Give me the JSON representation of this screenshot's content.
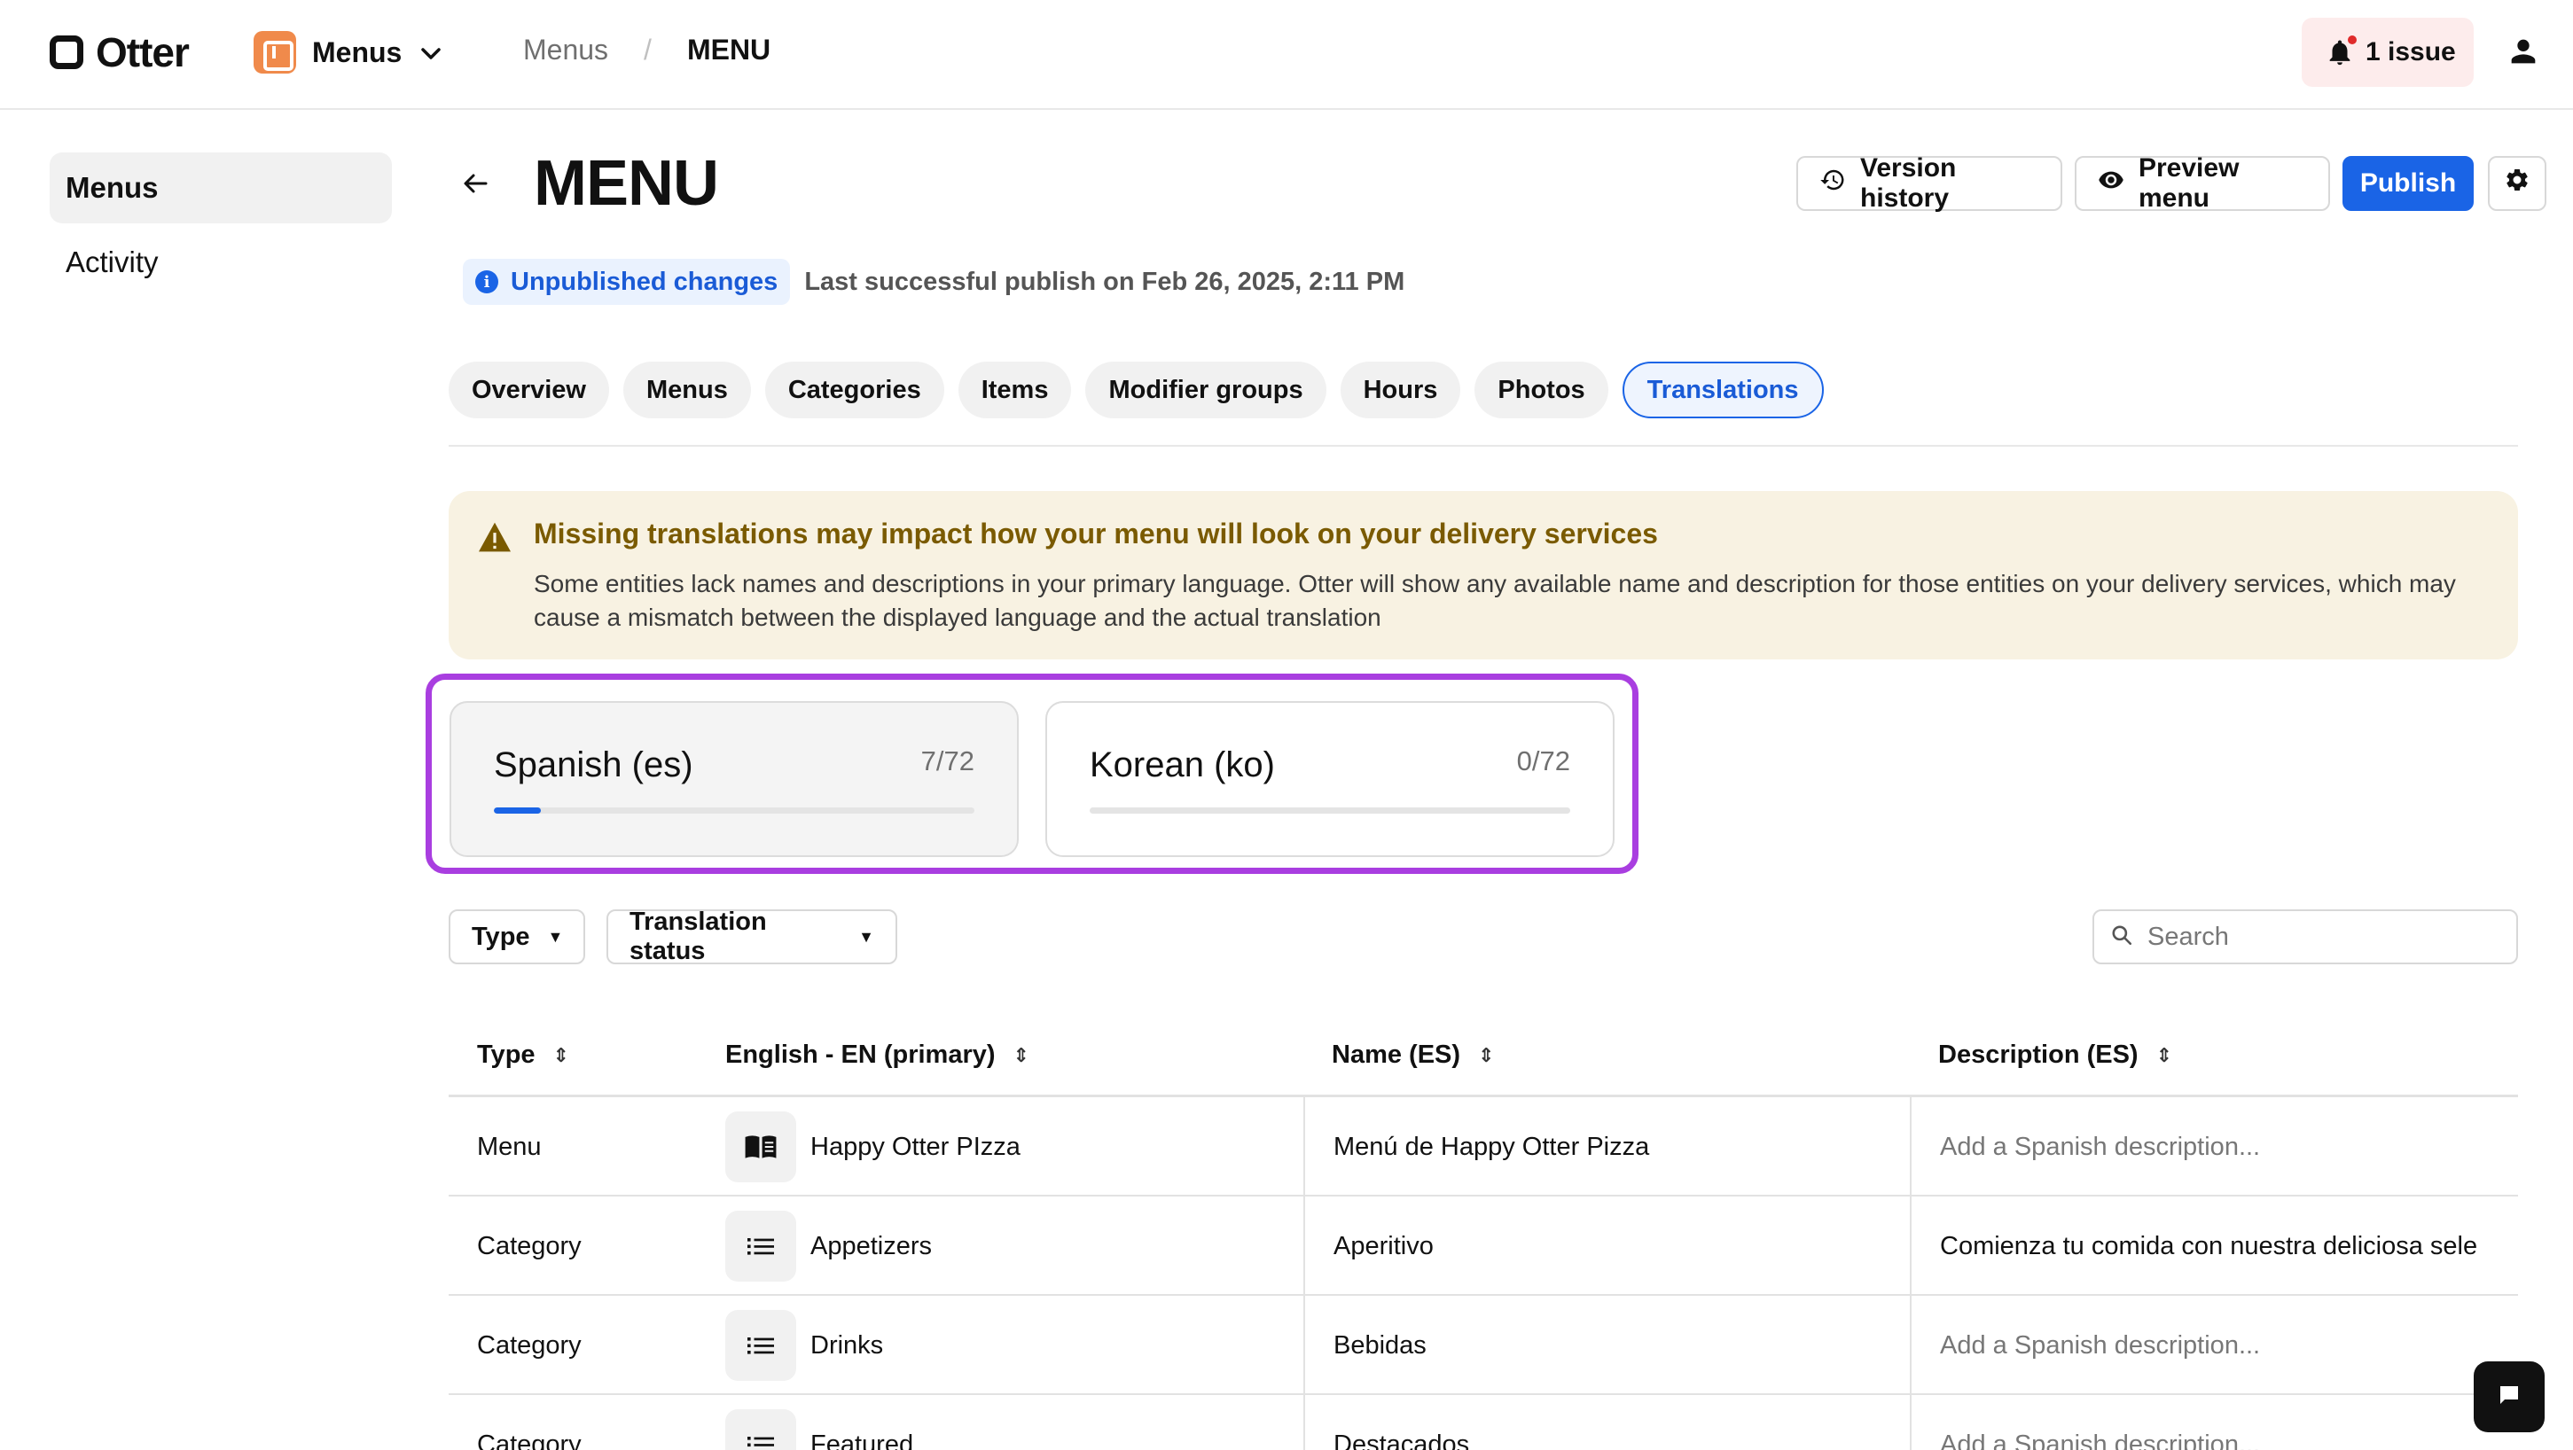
{
  "topbar": {
    "brand": "Otter",
    "app_name": "Menus",
    "breadcrumb": [
      "Menus",
      "MENU"
    ],
    "breadcrumb_sep": "/",
    "issues_label": "1 issue"
  },
  "sidebar": {
    "items": [
      {
        "label": "Menus",
        "active": true
      },
      {
        "label": "Activity",
        "active": false
      }
    ]
  },
  "header": {
    "title": "MENU",
    "version_history": "Version history",
    "preview_menu": "Preview menu",
    "publish": "Publish"
  },
  "status": {
    "badge": "Unpublished changes",
    "last_publish": "Last successful publish on Feb 26, 2025, 2:11 PM"
  },
  "tabs": [
    "Overview",
    "Menus",
    "Categories",
    "Items",
    "Modifier groups",
    "Hours",
    "Photos",
    "Translations"
  ],
  "active_tab": "Translations",
  "warning": {
    "title": "Missing translations may impact how your menu will look on your delivery services",
    "body": "Some entities lack names and descriptions in your primary language. Otter will show any available name and description for those entities on your delivery services, which may cause a mismatch between the displayed language and the actual translation"
  },
  "languages": [
    {
      "name": "Spanish (es)",
      "count": "7/72",
      "progress": 0.097,
      "selected": true
    },
    {
      "name": "Korean (ko)",
      "count": "0/72",
      "progress": 0,
      "selected": false
    }
  ],
  "filters": {
    "type": "Type",
    "translation_status": "Translation status",
    "search_placeholder": "Search"
  },
  "table": {
    "headers": [
      "Type",
      "English - EN (primary)",
      "Name (ES)",
      "Description (ES)"
    ],
    "rows": [
      {
        "type": "Menu",
        "icon": "menu-book-icon",
        "english": "Happy Otter PIzza",
        "name_es": "Menú de Happy Otter Pizza",
        "desc_es": "Add a Spanish description...",
        "desc_placeholder": true
      },
      {
        "type": "Category",
        "icon": "list-icon",
        "english": "Appetizers",
        "name_es": "Aperitivo",
        "desc_es": "Comienza tu comida con nuestra deliciosa sele",
        "desc_placeholder": false
      },
      {
        "type": "Category",
        "icon": "list-icon",
        "english": "Drinks",
        "name_es": "Bebidas",
        "desc_es": "Add a Spanish description...",
        "desc_placeholder": true
      },
      {
        "type": "Category",
        "icon": "list-icon",
        "english": "Featured",
        "name_es": "Destacados",
        "desc_es": "Add a Spanish description...",
        "desc_placeholder": true
      }
    ]
  },
  "colors": {
    "accent": "#1a64e6",
    "highlight": "#a93ee0",
    "warning_bg": "#f8f2e2",
    "warning_text": "#7a5a00"
  }
}
